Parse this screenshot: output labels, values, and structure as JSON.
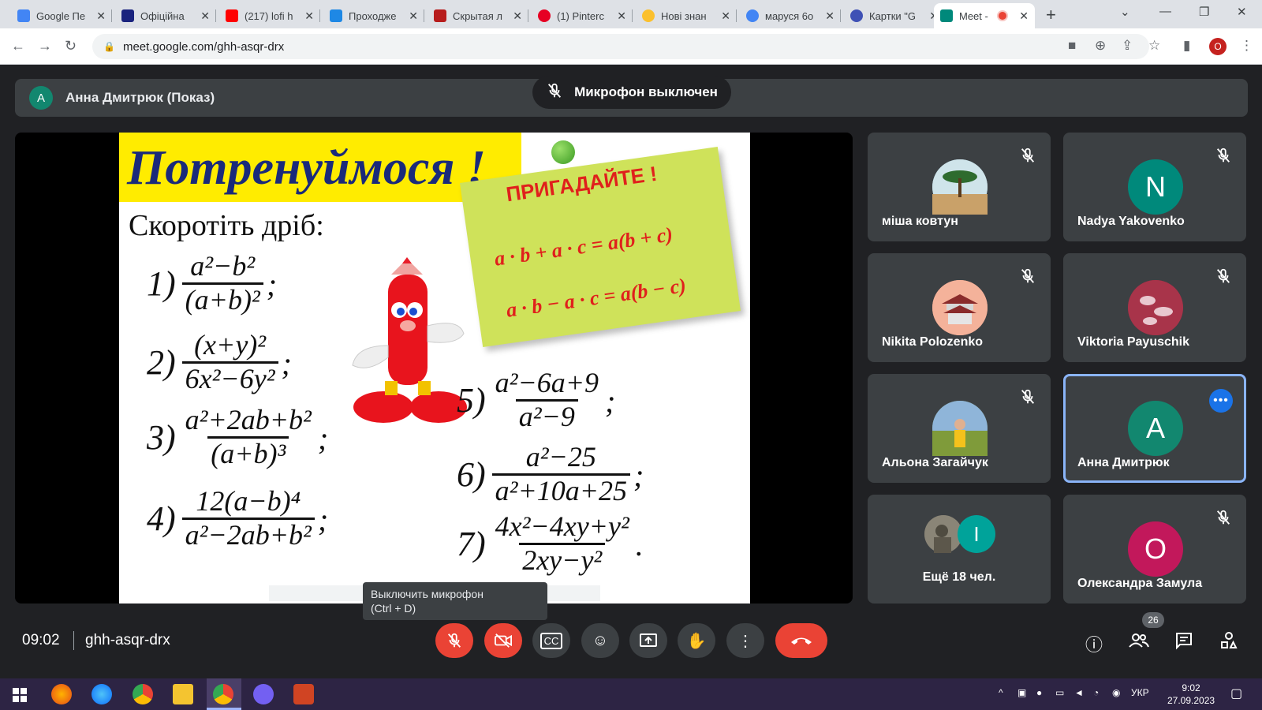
{
  "browser": {
    "tabs": [
      {
        "label": "Google Пе",
        "color": "#4285f4"
      },
      {
        "label": "Офіційна",
        "color": "#1a237e"
      },
      {
        "label": "(217) lofi h",
        "color": "#ff0000"
      },
      {
        "label": "Проходже",
        "color": "#1e88e5"
      },
      {
        "label": "Скрытая л",
        "color": "#b71c1c"
      },
      {
        "label": "(1) Pinterc",
        "color": "#e60023"
      },
      {
        "label": "Нові знан",
        "color": "#fbc02d"
      },
      {
        "label": "маруся 6о",
        "color": "#4285f4"
      },
      {
        "label": "Картки \"G",
        "color": "#3f51b5"
      },
      {
        "label": "Meet -",
        "color": "#00897b"
      }
    ],
    "new_tab": "+",
    "url": "meet.google.com/ghh-asqr-drx",
    "profile_initial": "O"
  },
  "meet": {
    "presenter": {
      "initial": "A",
      "label": "Анна Дмитрюк (Показ)"
    },
    "mic_toast": "Микрофон выключен",
    "tooltip": {
      "line1": "Выключить микрофон",
      "line2": "(Ctrl + D)"
    },
    "time": "09:02",
    "meeting_code": "ghh-asqr-drx",
    "people_count": "26",
    "participants": [
      {
        "name": "міша ковтун",
        "initial": "",
        "color": "#7aa7b8"
      },
      {
        "name": "Nadya Yakovenko",
        "initial": "N",
        "color": "#00897b"
      },
      {
        "name": "Nikita Polozenko",
        "initial": "",
        "color": "#e88f77"
      },
      {
        "name": "Viktoria Payuschik",
        "initial": "",
        "color": "#8e2438"
      },
      {
        "name": "Альона Загайчук",
        "initial": "",
        "color": "#6b8f4e"
      },
      {
        "name": "Анна Дмитрюк",
        "initial": "A",
        "color": "#12876f"
      },
      {
        "name": "Ещё 18 чел.",
        "initial": "I",
        "color": "#00a39a"
      },
      {
        "name": "Олександра Замула",
        "initial": "O",
        "color": "#c2185b"
      }
    ]
  },
  "slide": {
    "title": "Потренуймося !",
    "subtitle": "Скоротіть дріб:",
    "remember": "ПРИГАДАЙТЕ !",
    "formula1": "a · b + a · c = a(b + c)",
    "formula2": "a · b − a · c = a(b − c)",
    "exercises": [
      {
        "n": "1)",
        "top": "a²−b²",
        "bot": "(a+b)²",
        "end": ";"
      },
      {
        "n": "2)",
        "top": "(x+y)²",
        "bot": "6x²−6y²",
        "end": ";"
      },
      {
        "n": "3)",
        "top": "a²+2ab+b²",
        "bot": "(a+b)³",
        "end": ";"
      },
      {
        "n": "4)",
        "top": "12(a−b)⁴",
        "bot": "a²−2ab+b²",
        "end": ";"
      },
      {
        "n": "5)",
        "top": "a²−6a+9",
        "bot": "a²−9",
        "end": ";"
      },
      {
        "n": "6)",
        "top": "a²−25",
        "bot": "a²+10a+25",
        "end": ";"
      },
      {
        "n": "7)",
        "top": "4x²−4xy+y²",
        "bot": "2xy−y²",
        "end": "."
      }
    ]
  },
  "taskbar": {
    "lang": "УКР",
    "time": "9:02",
    "date": "27.09.2023"
  }
}
